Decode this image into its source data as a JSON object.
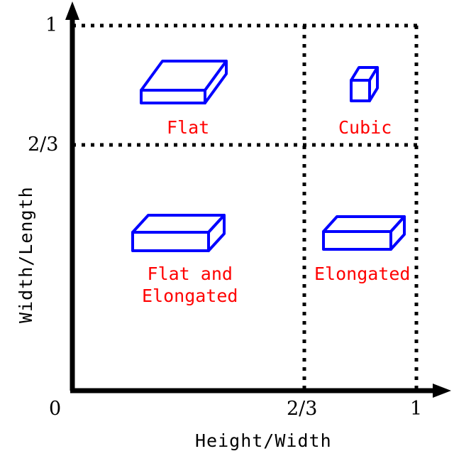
{
  "figure": {
    "type": "scatter-quadrant-diagram",
    "background": "#ffffff",
    "axis_color": "#000000",
    "grid_color": "#000000",
    "shape_color": "#0000ff",
    "label_color": "#ff0000"
  },
  "axes": {
    "x": {
      "title": "Height/Width",
      "origin_label": "0",
      "ticks": [
        {
          "value": "2/3"
        },
        {
          "value": "1"
        }
      ]
    },
    "y": {
      "title": "Width/Length",
      "ticks": [
        {
          "value": "1"
        },
        {
          "value": "2/3"
        }
      ]
    }
  },
  "quadrants": [
    {
      "id": "flat",
      "label": "Flat",
      "shape": "flat-slab",
      "region": "top-left",
      "x_range": "0 to 2/3",
      "y_range": "2/3 to 1"
    },
    {
      "id": "cubic",
      "label": "Cubic",
      "shape": "cube",
      "region": "top-right",
      "x_range": "2/3 to 1",
      "y_range": "2/3 to 1"
    },
    {
      "id": "flat-and-elongated",
      "label": "Flat and\nElongated",
      "shape": "flat-elongated-slab",
      "region": "bottom-left",
      "x_range": "0 to 2/3",
      "y_range": "0 to 2/3"
    },
    {
      "id": "elongated",
      "label": "Elongated",
      "shape": "elongated-bar",
      "region": "bottom-right",
      "x_range": "2/3 to 1",
      "y_range": "0 to 2/3"
    }
  ],
  "chart_data": {
    "type": "scatter",
    "title": "",
    "xlabel": "Height/Width",
    "ylabel": "Width/Length",
    "xlim": [
      0,
      1.08
    ],
    "ylim": [
      0,
      1.08
    ],
    "xticks": [
      "0",
      "2/3",
      "1"
    ],
    "yticks": [
      "2/3",
      "1"
    ],
    "grid": "dotted quadrant lines at x=2/3, x=1, y=2/3, y=1",
    "legend": "none",
    "annotations": [
      "Flat",
      "Cubic",
      "Flat and Elongated",
      "Elongated"
    ]
  }
}
